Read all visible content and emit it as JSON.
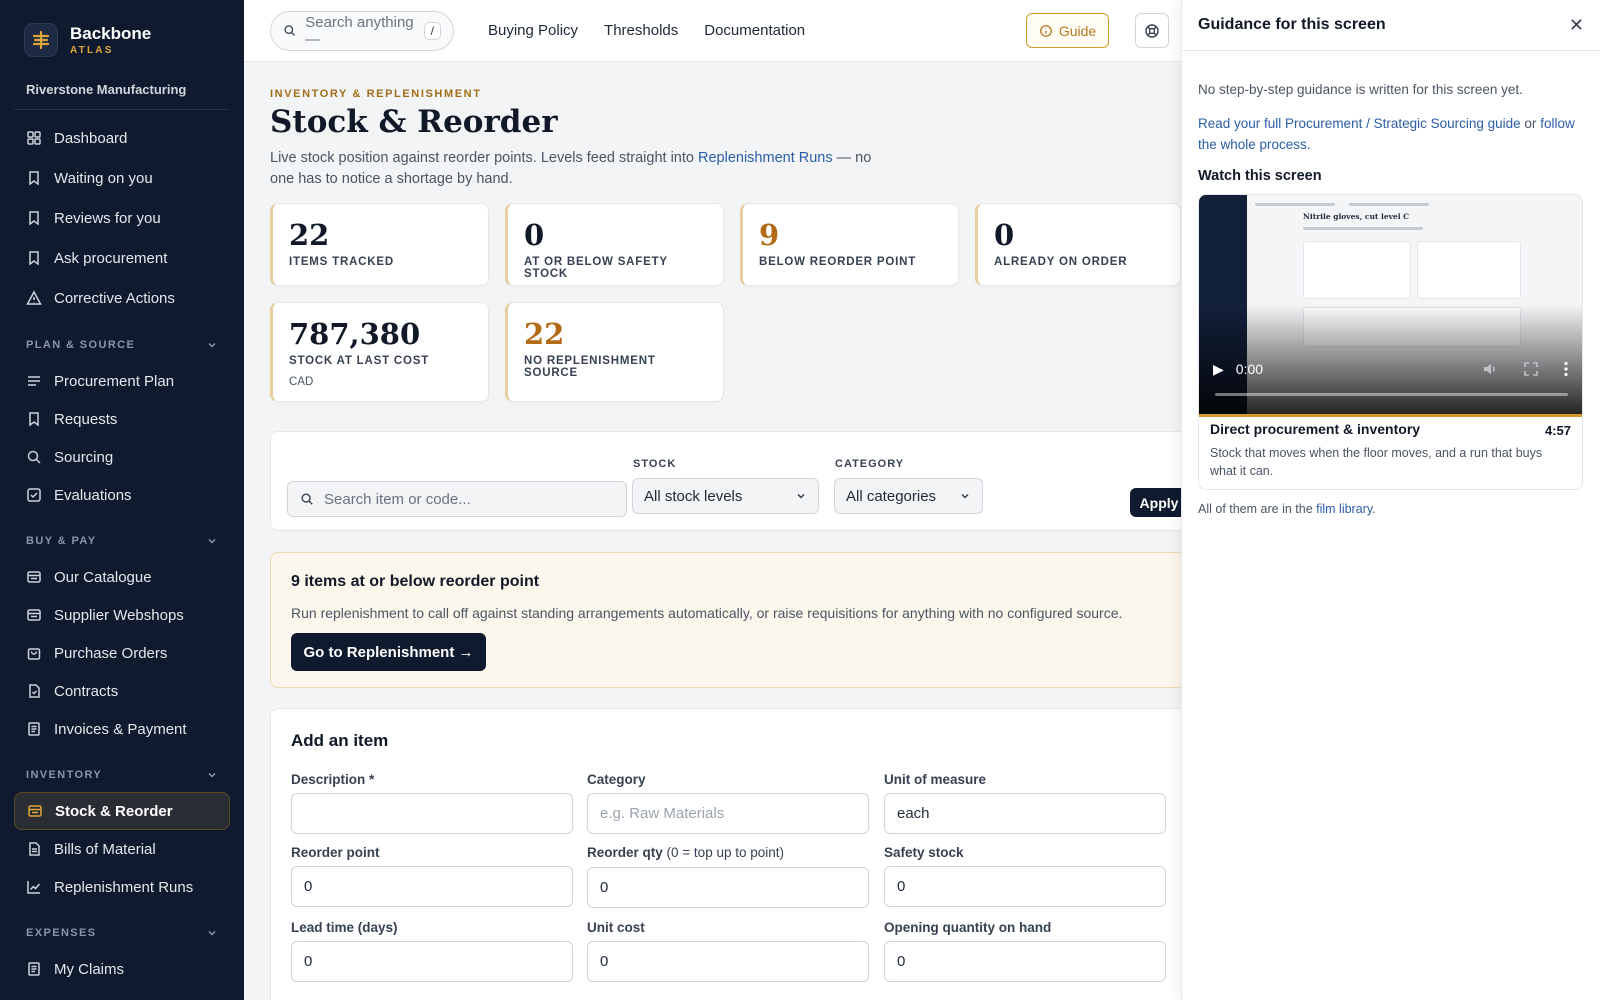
{
  "brand": {
    "name": "Backbone",
    "sub": "ATLAS",
    "org": "Riverstone Manufacturing"
  },
  "sidebar": {
    "top_items": [
      {
        "label": "Dashboard",
        "icon": "grid-icon"
      },
      {
        "label": "Waiting on you",
        "icon": "bookmark-icon"
      },
      {
        "label": "Reviews for you",
        "icon": "bookmark-icon"
      },
      {
        "label": "Ask procurement",
        "icon": "bookmark-icon"
      },
      {
        "label": "Corrective Actions",
        "icon": "warning-triangle-icon"
      }
    ],
    "sections": [
      {
        "title": "PLAN & SOURCE",
        "items": [
          {
            "label": "Procurement Plan",
            "icon": "list-icon"
          },
          {
            "label": "Requests",
            "icon": "bookmark-icon"
          },
          {
            "label": "Sourcing",
            "icon": "search-icon"
          },
          {
            "label": "Evaluations",
            "icon": "checkbox-icon"
          }
        ]
      },
      {
        "title": "BUY & PAY",
        "items": [
          {
            "label": "Our Catalogue",
            "icon": "catalogue-icon"
          },
          {
            "label": "Supplier Webshops",
            "icon": "catalogue-icon"
          },
          {
            "label": "Purchase Orders",
            "icon": "bag-icon"
          },
          {
            "label": "Contracts",
            "icon": "file-icon"
          },
          {
            "label": "Invoices & Payment",
            "icon": "receipt-icon"
          }
        ]
      },
      {
        "title": "INVENTORY",
        "items": [
          {
            "label": "Stock & Reorder",
            "icon": "box-icon",
            "active": true
          },
          {
            "label": "Bills of Material",
            "icon": "file-icon"
          },
          {
            "label": "Replenishment Runs",
            "icon": "trend-icon"
          }
        ]
      },
      {
        "title": "EXPENSES",
        "items": [
          {
            "label": "My Claims",
            "icon": "receipt-icon"
          }
        ]
      }
    ]
  },
  "topbar": {
    "search_placeholder": "Search anything —",
    "search_key": "/",
    "links": [
      "Buying Policy",
      "Thresholds",
      "Documentation"
    ],
    "guide_label": "Guide"
  },
  "page": {
    "eyebrow": "INVENTORY & REPLENISHMENT",
    "title": "Stock & Reorder",
    "desc_before": "Live stock position against reorder points. Levels feed straight into ",
    "desc_link": "Replenishment Runs",
    "desc_after": " — no one has to notice a shortage by hand."
  },
  "stats": [
    {
      "value": "22",
      "label": "ITEMS TRACKED",
      "accent": false
    },
    {
      "value": "0",
      "label": "AT OR BELOW SAFETY STOCK",
      "accent": false
    },
    {
      "value": "9",
      "label": "BELOW REORDER POINT",
      "accent": true
    },
    {
      "value": "0",
      "label": "ALREADY ON ORDER",
      "accent": false
    },
    {
      "value": "787,380",
      "label": "STOCK AT LAST COST",
      "unit": "CAD",
      "accent": false
    },
    {
      "value": "22",
      "label": "NO REPLENISHMENT SOURCE",
      "accent": true
    }
  ],
  "filters": {
    "search_placeholder": "Search item or code...",
    "stock_label": "STOCK",
    "stock_value": "All stock levels",
    "category_label": "CATEGORY",
    "category_value": "All categories",
    "apply_label": "Apply"
  },
  "alert": {
    "title": "9 items at or below reorder point",
    "text": "Run replenishment to call off against standing arrangements automatically, or raise requisitions for anything with no configured source.",
    "button": "Go to Replenishment →"
  },
  "add_item": {
    "title": "Add an item",
    "fields": {
      "description": {
        "label": "Description *",
        "value": ""
      },
      "category": {
        "label": "Category",
        "placeholder": "e.g. Raw Materials"
      },
      "uom": {
        "label": "Unit of measure",
        "value": "each"
      },
      "reorder_point": {
        "label": "Reorder point",
        "value": "0"
      },
      "reorder_qty": {
        "label": "Reorder qty",
        "label_note": "(0 = top up to point)",
        "value": "0"
      },
      "safety_stock": {
        "label": "Safety stock",
        "value": "0"
      },
      "lead_time": {
        "label": "Lead time (days)",
        "value": "0"
      },
      "unit_cost": {
        "label": "Unit cost",
        "value": "0"
      },
      "opening_qty": {
        "label": "Opening quantity on hand",
        "value": "0"
      }
    }
  },
  "guidance": {
    "title": "Guidance for this screen",
    "note": "No step-by-step guidance is written for this screen yet.",
    "link1": "Read your full Procurement / Strategic Sourcing guide",
    "link_or": " or ",
    "link2": "follow the whole process.",
    "watch_title": "Watch this screen",
    "video_inner_title": "Nitrile gloves, cut level C",
    "video_time": "0:00",
    "film_title": "Direct procurement & inventory",
    "film_duration": "4:57",
    "film_desc": "Stock that moves when the floor moves, and a run that buys what it can.",
    "footer_before": "All of them are in the ",
    "footer_link": "film library",
    "footer_after": "."
  },
  "colors": {
    "sidebar_bg": "#0f1a2e",
    "accent": "#d59a2c",
    "link": "#2b5ea7",
    "amber_value": "#b26a16"
  }
}
